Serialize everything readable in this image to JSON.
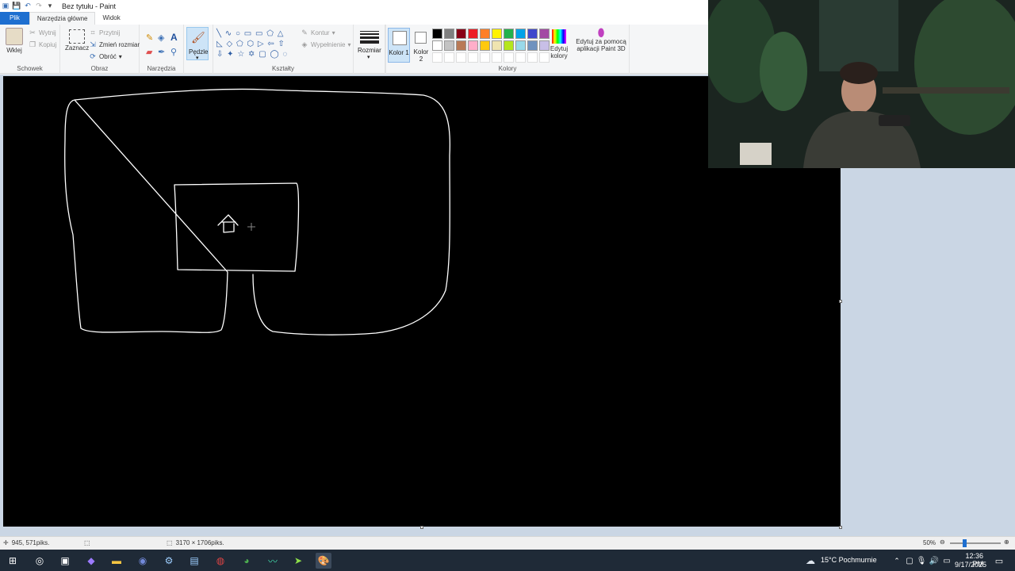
{
  "window": {
    "title": "Bez tytułu - Paint"
  },
  "tabs": [
    {
      "label": "Plik"
    },
    {
      "label": "Narzędzia główne"
    },
    {
      "label": "Widok"
    }
  ],
  "ribbon": {
    "clipboard": {
      "label": "Schowek",
      "paste": "Wklej",
      "cut": "Wytnij",
      "copy": "Kopiuj"
    },
    "image": {
      "label": "Obraz",
      "select": "Zaznacz",
      "crop": "Przytnij",
      "resize": "Zmień rozmiar",
      "rotate": "Obróć"
    },
    "tools": {
      "label": "Narzędzia"
    },
    "brushes": {
      "label": "Pędzle"
    },
    "shapes": {
      "label": "Kształty",
      "outline": "Kontur",
      "fill": "Wypełnienie"
    },
    "size": {
      "label": "Rozmiar"
    },
    "colors": {
      "label": "Kolory",
      "color1_label": "Kolor 1",
      "color2_label": "Kolor 2",
      "edit_colors": "Edytuj kolory",
      "paint3d": "Edytuj za pomocą aplikacji Paint 3D",
      "palette_row1": [
        "#000000",
        "#7f7f7f",
        "#880015",
        "#ed1c24",
        "#ff7f27",
        "#fff200",
        "#22b14c",
        "#00a2e8",
        "#3f48cc",
        "#a349a4"
      ],
      "palette_row2": [
        "#ffffff",
        "#c3c3c3",
        "#b97a57",
        "#ffaec9",
        "#ffc90e",
        "#efe4b0",
        "#b5e61d",
        "#99d9ea",
        "#7092be",
        "#c8bfe7"
      ]
    }
  },
  "status": {
    "cursor_position": "945, 571piks.",
    "canvas_size": "3170 × 1706piks.",
    "zoom": "50%"
  },
  "taskbar": {
    "weather": "15°C  Pochmurnie",
    "time": "12:36 PM",
    "date": "9/17/2025"
  }
}
